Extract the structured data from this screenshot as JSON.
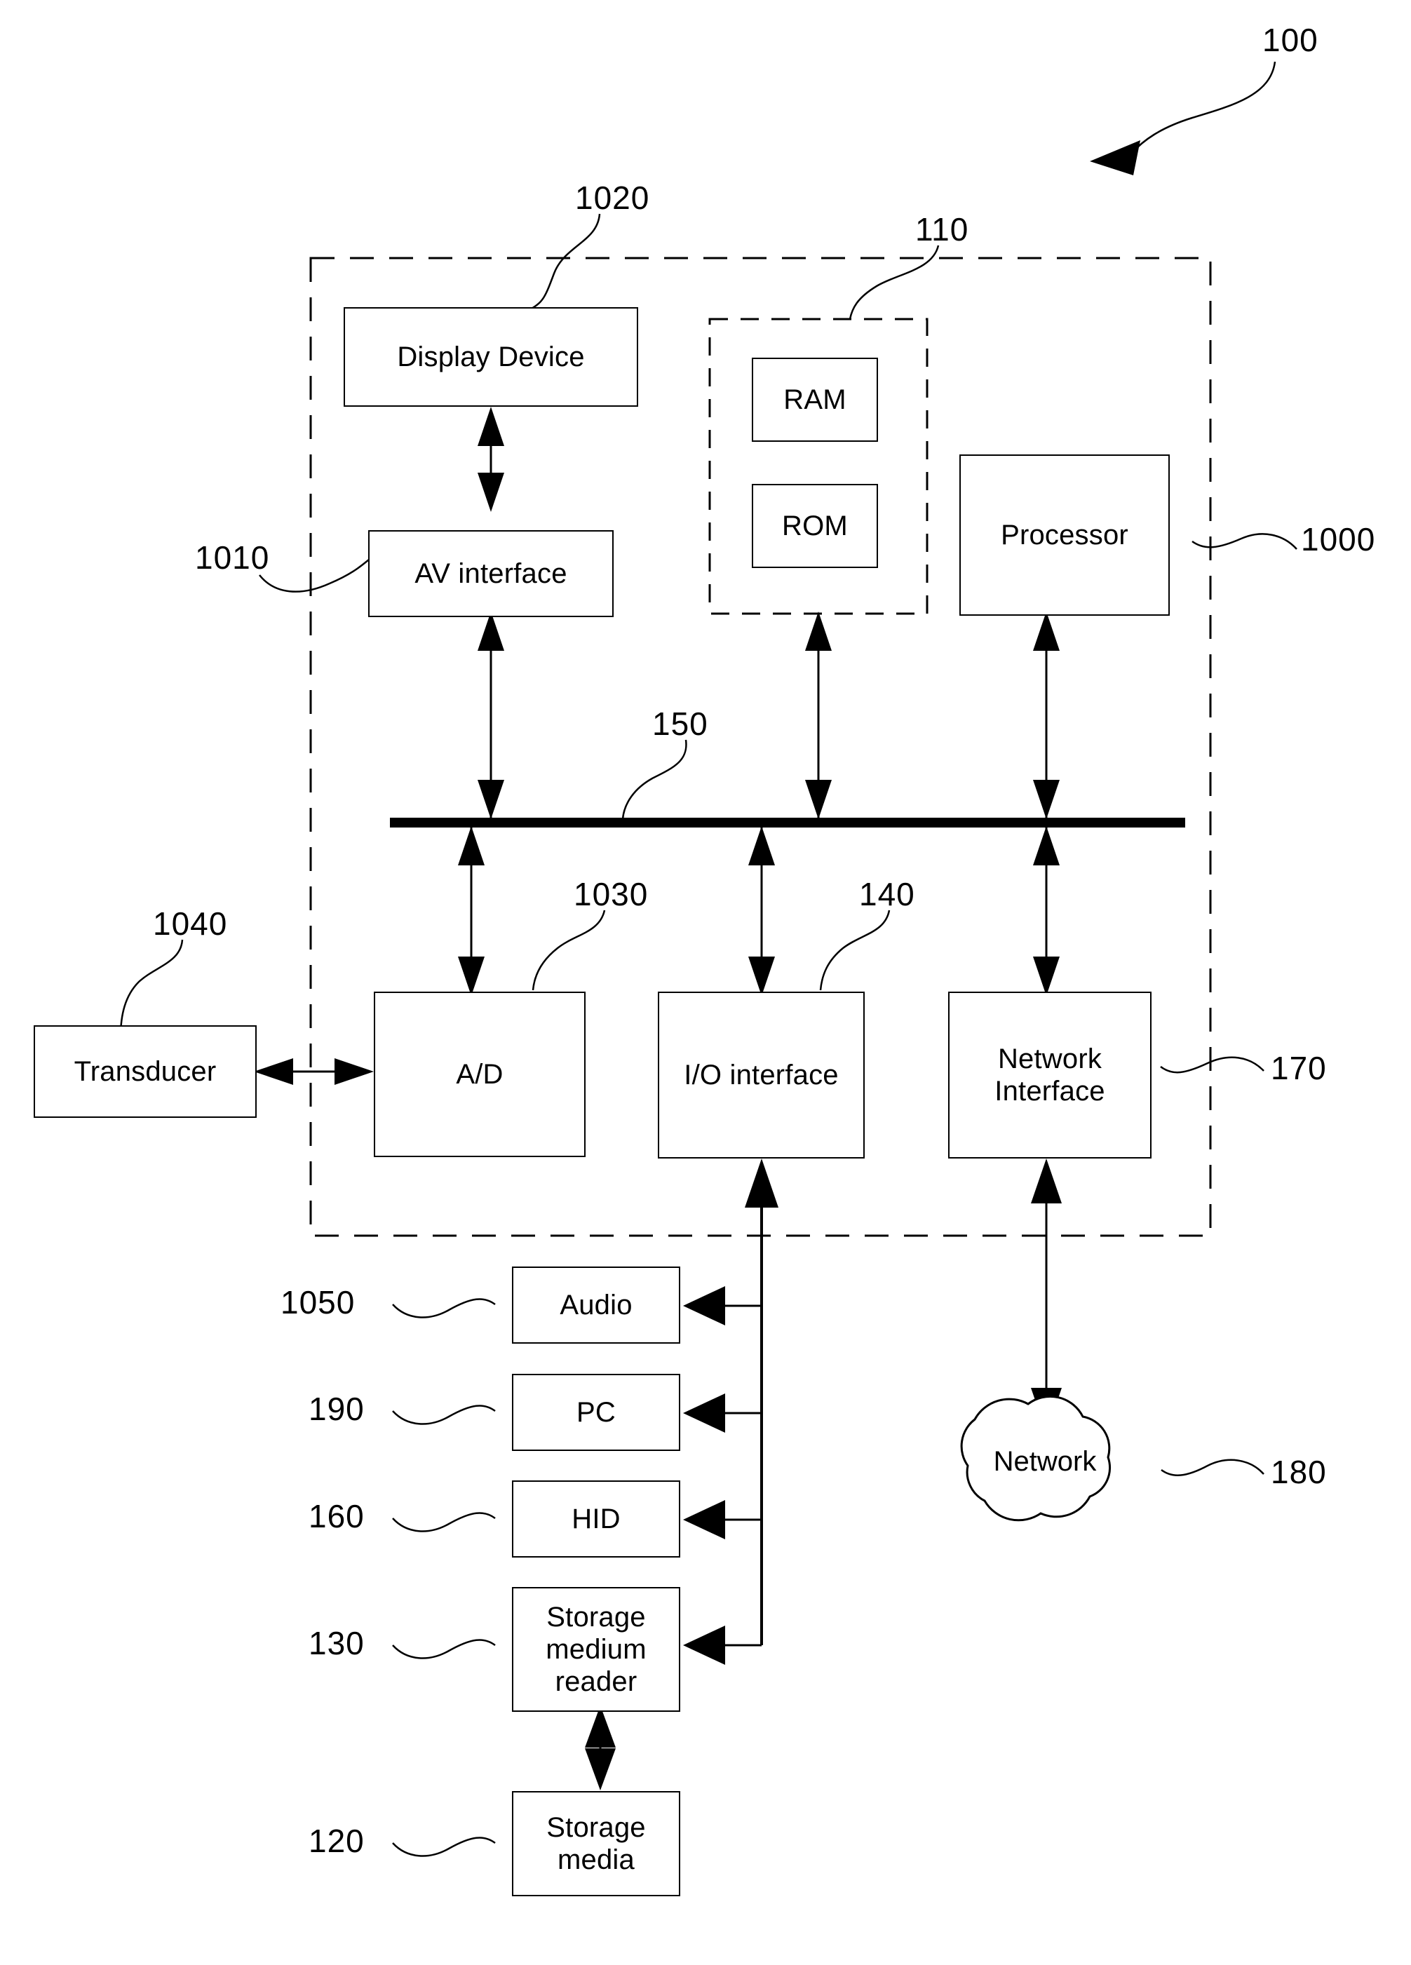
{
  "figure": {
    "type": "patent-block-diagram",
    "overall_ref": "100"
  },
  "boundary": {
    "system_ref": "100",
    "memory_group_ref": "110"
  },
  "nodes": {
    "display_device": {
      "label": "Display Device",
      "ref": "1020"
    },
    "ram": {
      "label": "RAM",
      "ref": ""
    },
    "rom": {
      "label": "ROM",
      "ref": ""
    },
    "processor": {
      "label": "Processor",
      "ref": "1000"
    },
    "av_interface": {
      "label": "AV interface",
      "ref": "1010"
    },
    "bus": {
      "label": "",
      "ref": "150"
    },
    "transducer": {
      "label": "Transducer",
      "ref": "1040"
    },
    "ad": {
      "label": "A/D",
      "ref": "1030"
    },
    "io_interface": {
      "label": "I/O interface",
      "ref": "140"
    },
    "network_interface": {
      "label": "Network\nInterface",
      "line1": "Network",
      "line2": "Interface",
      "ref": "170"
    },
    "audio": {
      "label": "Audio",
      "ref": "1050"
    },
    "pc": {
      "label": "PC",
      "ref": "190"
    },
    "hid": {
      "label": "HID",
      "ref": "160"
    },
    "storage_reader": {
      "label": "Storage medium reader",
      "line1": "Storage",
      "line2": "medium",
      "line3": "reader",
      "ref": "130"
    },
    "storage_media": {
      "label": "Storage media",
      "line1": "Storage",
      "line2": "media",
      "ref": "120"
    },
    "network_cloud": {
      "label": "Network",
      "ref": "180"
    }
  },
  "refs": {
    "r100": "100",
    "r110": "110",
    "r120": "120",
    "r130": "130",
    "r140": "140",
    "r150": "150",
    "r160": "160",
    "r170": "170",
    "r180": "180",
    "r190": "190",
    "r1000": "1000",
    "r1010": "1010",
    "r1020": "1020",
    "r1030": "1030",
    "r1040": "1040",
    "r1050": "1050"
  },
  "colors": {
    "stroke": "#000000",
    "background": "#ffffff"
  }
}
